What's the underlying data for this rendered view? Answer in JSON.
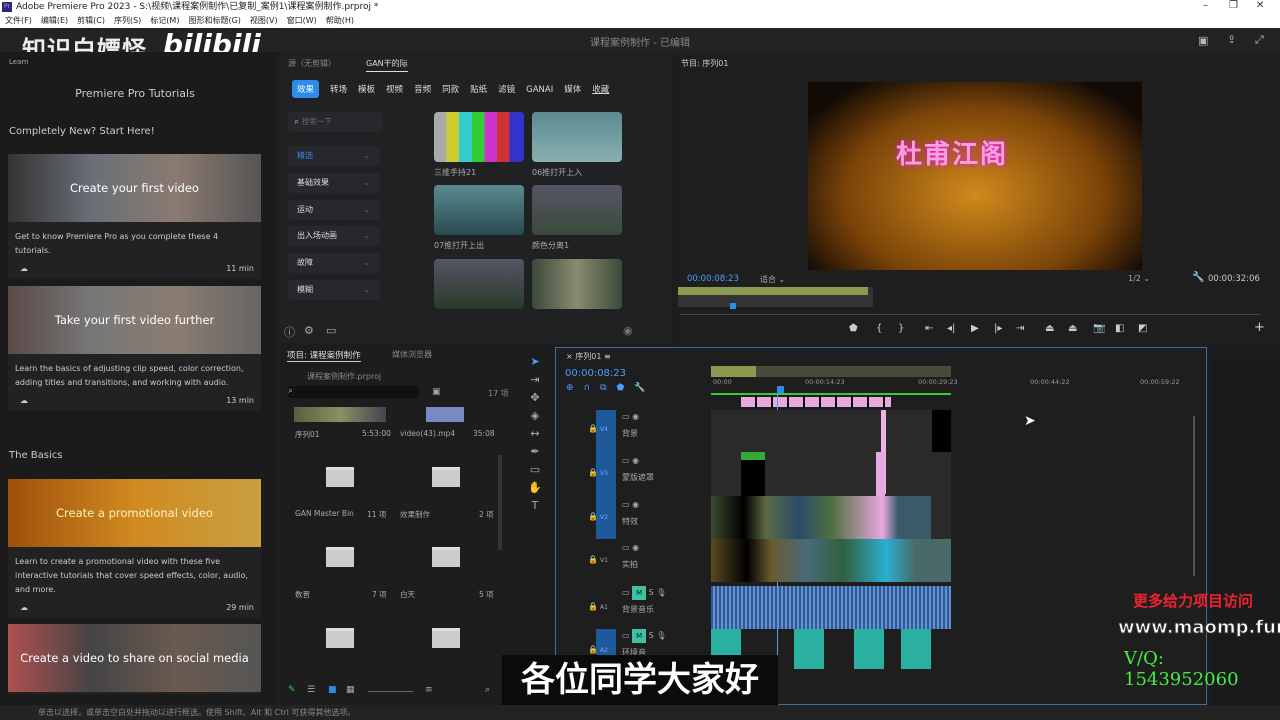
{
  "window": {
    "title": "Adobe Premiere Pro 2023 - S:\\视频\\课程案例制作\\已复制_案例1\\课程案例制作.prproj *",
    "app_icon": "Pr"
  },
  "menu": [
    "文件(F)",
    "编辑(E)",
    "剪辑(C)",
    "序列(S)",
    "标记(M)",
    "图形和标题(G)",
    "视图(V)",
    "窗口(W)",
    "帮助(H)"
  ],
  "header": {
    "watermark": "知识白嫖怪",
    "bili": "bilibili",
    "project_title": "课程案例制作 - 已编辑"
  },
  "learn": {
    "tab": "Learn",
    "title": "Premiere Pro Tutorials",
    "section1": "Completely New? Start Here!",
    "section2": "The Basics",
    "cards": [
      {
        "title": "Create your first video",
        "desc": "Get to know Premiere Pro as you complete these 4 tutorials.",
        "time": "11 min"
      },
      {
        "title": "Take your first video further",
        "desc": "Learn the basics of adjusting clip speed, color correction, adding titles and transitions, and working with audio.",
        "time": "13 min"
      },
      {
        "title": "Create a promotional video",
        "desc": "Learn to create a promotional video with these five interactive tutorials that cover speed effects, color, audio, and more.",
        "time": "29 min"
      },
      {
        "title": "Create a video to share on social media"
      }
    ]
  },
  "effects": {
    "tab_left": "源（无剪辑）",
    "tab_active": "GAN干的际",
    "tabs": [
      "效果",
      "转场",
      "模板",
      "视频",
      "音频",
      "同款",
      "贴纸",
      "滤镜",
      "GANAI",
      "媒体",
      "收藏"
    ],
    "search_placeholder": "搜索一下",
    "categories": [
      "精选",
      "基础效果",
      "运动",
      "出入场动画",
      "故障",
      "模糊"
    ],
    "items": [
      "三维手持21",
      "06推打开上入",
      "07推打开上出",
      "颜色分离1"
    ]
  },
  "program": {
    "tab": "节目: 序列01",
    "timecode": "00:00:08:23",
    "fit": "适合",
    "quality": "1/2",
    "duration": "00:00:32:06",
    "sign": "杜甫江阁"
  },
  "project": {
    "tab": "项目: 课程案例制作",
    "tab2": "媒体浏览器",
    "file": "课程案例制作.prproj",
    "count": "17 项",
    "items": [
      {
        "name": "序列01",
        "info": "5:53:00"
      },
      {
        "name": "video(43).mp4",
        "info": "35:08"
      },
      {
        "name": "GAN Master Bin",
        "info": "11 项"
      },
      {
        "name": "效果制作",
        "info": "2 项"
      },
      {
        "name": "数晋",
        "info": "7 项"
      },
      {
        "name": "白天",
        "info": "5 项"
      }
    ]
  },
  "timeline": {
    "tab": "序列01",
    "timecode": "00:00:08:23",
    "ruler": [
      "00:00",
      "00:00:14:23",
      "00:00:29:23",
      "00:00:44:22",
      "00:00:59:22"
    ],
    "tracks": [
      {
        "id": "V4",
        "name": "背景"
      },
      {
        "id": "V3",
        "name": "蒙版遮罩"
      },
      {
        "id": "V2",
        "name": "特效"
      },
      {
        "id": "V1",
        "name": "实拍"
      },
      {
        "id": "A1",
        "name": "背景音乐"
      },
      {
        "id": "A2",
        "name": "环境音"
      }
    ],
    "mute": "M",
    "solo": "S"
  },
  "subtitle": "各位同学大家好",
  "promo": {
    "line1": "更多给力项目访问",
    "line2": "www.maomp.fun",
    "line3": "V/Q: 1543952060"
  },
  "status": "单击以选择，或单击空白处并拖动以进行框选。使用 Shift、Alt 和 Ctrl 可获得其他选项。",
  "colors": {
    "accent": "#2d8ceb",
    "mute_on": "#3ec2a0",
    "timecode": "#4a9eff"
  }
}
